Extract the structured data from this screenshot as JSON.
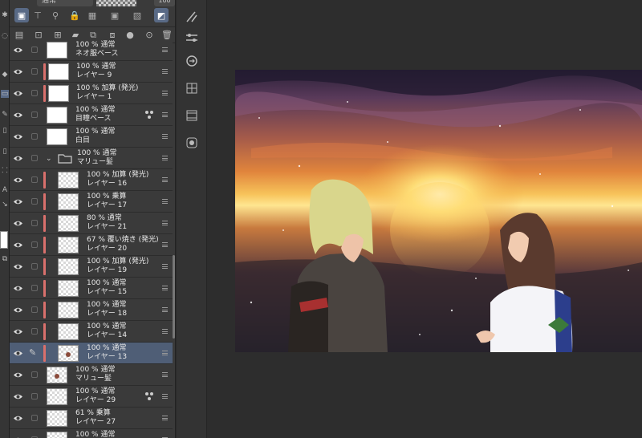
{
  "top_bar": {
    "blend_mode": "通常",
    "opacity": "100"
  },
  "layers": [
    {
      "name": "ネオ服ベース",
      "mode": "100 % 通常",
      "clip": false,
      "thumb": "white",
      "ref": false,
      "selected": false
    },
    {
      "name": "レイヤー 9",
      "mode": "100 % 通常",
      "clip": true,
      "thumb": "white",
      "ref": false,
      "selected": false
    },
    {
      "name": "レイヤー 1",
      "mode": "100 % 加算 (発光)",
      "clip": true,
      "thumb": "white",
      "ref": false,
      "selected": false
    },
    {
      "name": "目瞳ベース",
      "mode": "100 % 通常",
      "clip": false,
      "thumb": "white",
      "ref": true,
      "selected": false
    },
    {
      "name": "白目",
      "mode": "100 % 通常",
      "clip": false,
      "thumb": "white",
      "ref": false,
      "selected": false
    },
    {
      "name": "マリュー髪",
      "mode": "100 % 通常",
      "clip": false,
      "thumb": "folder",
      "ref": false,
      "selected": false
    },
    {
      "name": "レイヤー 16",
      "mode": "100 % 加算 (発光)",
      "clip": true,
      "thumb": "checker",
      "ref": false,
      "selected": false
    },
    {
      "name": "レイヤー 17",
      "mode": "100 % 乗算",
      "clip": true,
      "thumb": "checker",
      "ref": false,
      "selected": false
    },
    {
      "name": "レイヤー 21",
      "mode": "80 % 通常",
      "clip": true,
      "thumb": "checker",
      "ref": false,
      "selected": false
    },
    {
      "name": "レイヤー 20",
      "mode": "67 % 覆い焼き (発光)",
      "clip": true,
      "thumb": "checker",
      "ref": false,
      "selected": false
    },
    {
      "name": "レイヤー 19",
      "mode": "100 % 加算 (発光)",
      "clip": true,
      "thumb": "checker",
      "ref": false,
      "selected": false
    },
    {
      "name": "レイヤー 15",
      "mode": "100 % 通常",
      "clip": true,
      "thumb": "checker",
      "ref": false,
      "selected": false
    },
    {
      "name": "レイヤー 18",
      "mode": "100 % 通常",
      "clip": true,
      "thumb": "checker",
      "ref": false,
      "selected": false
    },
    {
      "name": "レイヤー 14",
      "mode": "100 % 通常",
      "clip": true,
      "thumb": "checker",
      "ref": false,
      "selected": false
    },
    {
      "name": "レイヤー 13",
      "mode": "100 % 通常",
      "clip": true,
      "thumb": "checker-dot",
      "ref": false,
      "selected": true
    },
    {
      "name": "マリュー髪",
      "mode": "100 % 通常",
      "clip": false,
      "thumb": "checker-dot",
      "ref": false,
      "selected": false
    },
    {
      "name": "レイヤー 29",
      "mode": "100 % 通常",
      "clip": false,
      "thumb": "checker",
      "ref": true,
      "selected": false
    },
    {
      "name": "レイヤー 27",
      "mode": "61 % 乗算",
      "clip": false,
      "thumb": "checker",
      "ref": false,
      "selected": false
    },
    {
      "name": "",
      "mode": "100 % 通常",
      "clip": false,
      "thumb": "checker",
      "ref": false,
      "selected": false
    }
  ],
  "colors": {
    "selected_row": "#4f5e76",
    "clip_bar": "#d9706c",
    "panel_bg": "#3a3a3a",
    "canvas_bg": "#2d2d2d"
  }
}
